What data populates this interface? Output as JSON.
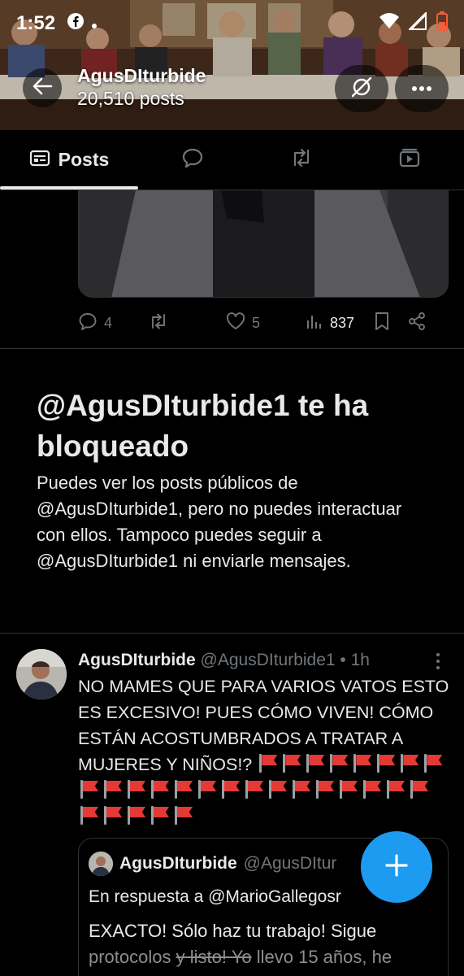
{
  "status_bar": {
    "time": "1:52",
    "icons_left": [
      "facebook-icon",
      "dot-icon"
    ],
    "icons_right": [
      "wifi-icon",
      "signal-icon",
      "battery-icon"
    ]
  },
  "header": {
    "display_name": "AgusDIturbide",
    "posts_count": "20,510 posts",
    "icons": [
      "back-arrow-icon",
      "grok-icon",
      "more-icon"
    ]
  },
  "tabs": [
    {
      "label": "Posts",
      "icon": "posts-icon",
      "selected": true
    },
    {
      "label": "",
      "icon": "replies-icon",
      "selected": false
    },
    {
      "label": "",
      "icon": "reposts-icon",
      "selected": false
    },
    {
      "label": "",
      "icon": "media-icon",
      "selected": false
    }
  ],
  "previous_post": {
    "replies": "4",
    "likes": "5",
    "views": "837"
  },
  "blocked": {
    "title": "@AgusDIturbide1 te ha bloqueado",
    "description": "Puedes ver los posts públicos de @AgusDIturbide1, pero no puedes interactuar con ellos. Tampoco puedes seguir a @AgusDIturbide1 ni enviarle mensajes."
  },
  "tweet": {
    "name": "AgusDIturbide",
    "handle": "@AgusDIturbide1",
    "separator": " • ",
    "time": "1h",
    "text": "NO MAMES QUE PARA VARIOS VATOS ESTO ES EXCESIVO! PUES CÓMO VIVEN! CÓMO ESTÁN ACOSTUMBRADOS A TRATAR A MUJERES Y NIÑOS!?",
    "red_flag_count": 28
  },
  "quote": {
    "name": "AgusDIturbide",
    "handle": "@AgusDItur",
    "reply_prefix": "En respuesta a",
    "reply_to": "@MarioGallegosr",
    "text_line1": "EXACTO! Sólo haz tu trabajo! Sigue",
    "text_line2_a": "protocolos",
    "text_line2_strike": "y listo! Yo",
    "text_line2_b": "llevo 15 años, he"
  },
  "colors": {
    "accent": "#1d9bf0",
    "background": "#000000",
    "text": "#e7e9ea",
    "muted": "#71767b",
    "border": "#2f3336",
    "flag_red": "#e53935"
  }
}
